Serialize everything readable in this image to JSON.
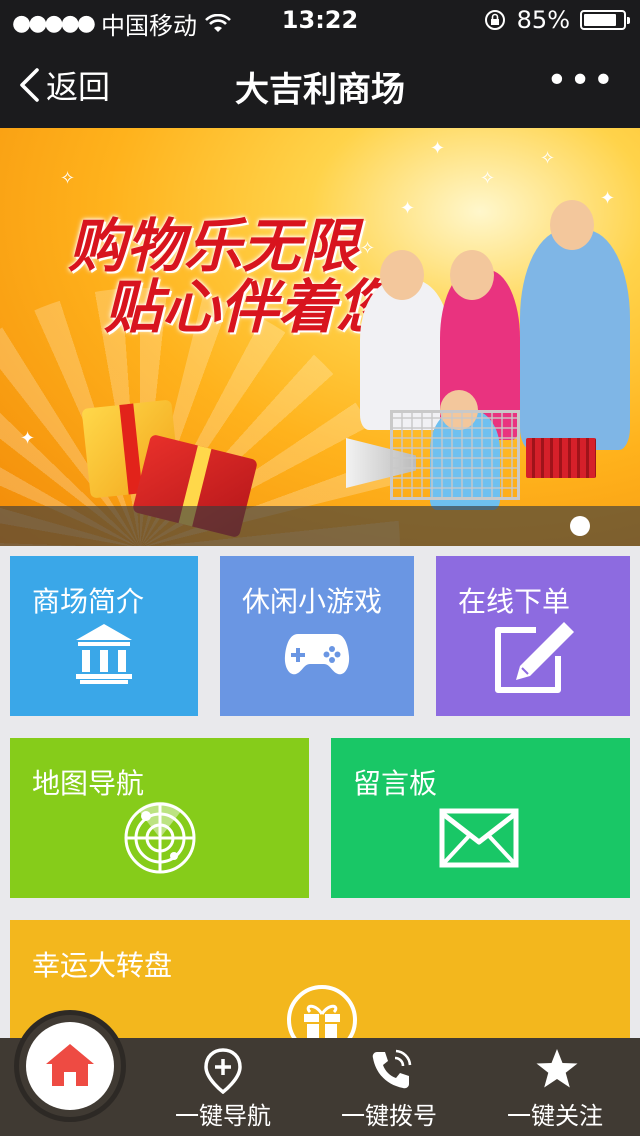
{
  "status_bar": {
    "carrier": "中国移动",
    "time": "13:22",
    "battery": "85%",
    "battery_level": 0.85,
    "icons": [
      "signal-dots-icon",
      "wifi-icon",
      "rotation-lock-icon",
      "battery-icon"
    ]
  },
  "nav_bar": {
    "back_label": "返回",
    "title": "大吉利商场",
    "more_label": "•••"
  },
  "banner": {
    "slogan_line1": "购物乐无限",
    "slogan_line2": "贴心伴着您",
    "active_slide": 1,
    "slide_count": 1
  },
  "tiles": {
    "intro": {
      "label": "商场简介",
      "icon": "building-icon",
      "color": "#3aa7e8"
    },
    "game": {
      "label": "休闲小游戏",
      "icon": "gamepad-icon",
      "color": "#6a96e3"
    },
    "order": {
      "label": "在线下单",
      "icon": "edit-icon",
      "color": "#8d6be0"
    },
    "map": {
      "label": "地图导航",
      "icon": "radar-icon",
      "color": "#86cc1a"
    },
    "message": {
      "label": "留言板",
      "icon": "mail-icon",
      "color": "#19c766"
    },
    "wheel": {
      "label": "幸运大转盘",
      "icon": "gift-icon",
      "color": "#f3b71d"
    }
  },
  "bottom_bar": {
    "home_icon": "home-icon",
    "items": [
      {
        "label": "一键导航",
        "icon": "location-plus-icon"
      },
      {
        "label": "一键拨号",
        "icon": "phone-icon"
      },
      {
        "label": "一键关注",
        "icon": "star-icon"
      }
    ]
  }
}
